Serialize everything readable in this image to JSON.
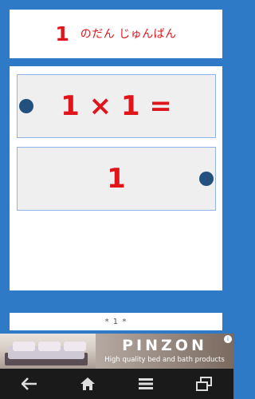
{
  "header": {
    "number": "1",
    "title": "のだん じゅんばん"
  },
  "question": {
    "text": "1 × 1 ="
  },
  "answer": {
    "text": "1"
  },
  "pagination": {
    "indicator": "* 1 *"
  },
  "ad": {
    "brand": "PINZON",
    "tagline": "High quality bed and bath products",
    "info_glyph": "i"
  },
  "colors": {
    "background": "#2f7ac7",
    "accent_red": "#e0141b",
    "dot": "#22507f",
    "panel": "#efefef"
  },
  "nav": {
    "icons": [
      "back-icon",
      "home-icon",
      "menu-icon",
      "recent-apps-icon"
    ]
  }
}
